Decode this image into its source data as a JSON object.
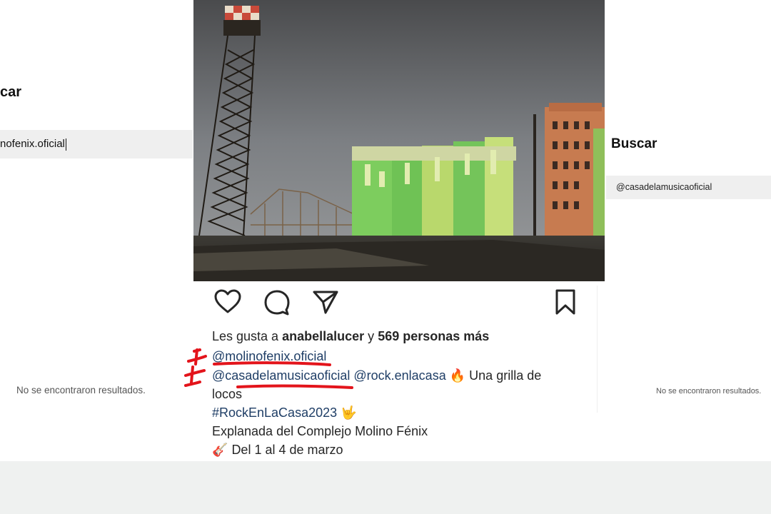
{
  "left_panel": {
    "title": "car",
    "search_value": "nofenix.oficial",
    "empty_message": "No se encontraron resultados."
  },
  "right_panel": {
    "title": "Buscar",
    "search_value": "@casadelamusicaoficial",
    "empty_message": "No se encontraron resultados."
  },
  "post": {
    "image_description": "industrial-silos-photo",
    "actions": [
      "heart-icon",
      "comment-icon",
      "share-icon",
      "bookmark-icon"
    ],
    "likes": {
      "prefix": "Les gusta a",
      "user": "anabellalucer",
      "connector": "y",
      "count_text": "569 personas más"
    },
    "caption": {
      "mention_1": "@molinofenix.oficial",
      "mention_2": "@casadelamusicaoficial",
      "mention_3": "@rock.enlacasa",
      "fire_emoji": "🔥",
      "text_1": "Una grilla de",
      "text_2": "locos",
      "hashtag": "#RockEnLaCasa2023",
      "rock_emoji": "🤟",
      "venue": "Explanada del Complejo Molino Fénix",
      "guitar_emoji": "🎸",
      "dates": "Del 1 al 4 de marzo"
    }
  },
  "colors": {
    "link": "#1f3e66",
    "annotation_red": "#e3141b",
    "search_bg": "#efefef",
    "bottom_band": "#eff1f0"
  }
}
